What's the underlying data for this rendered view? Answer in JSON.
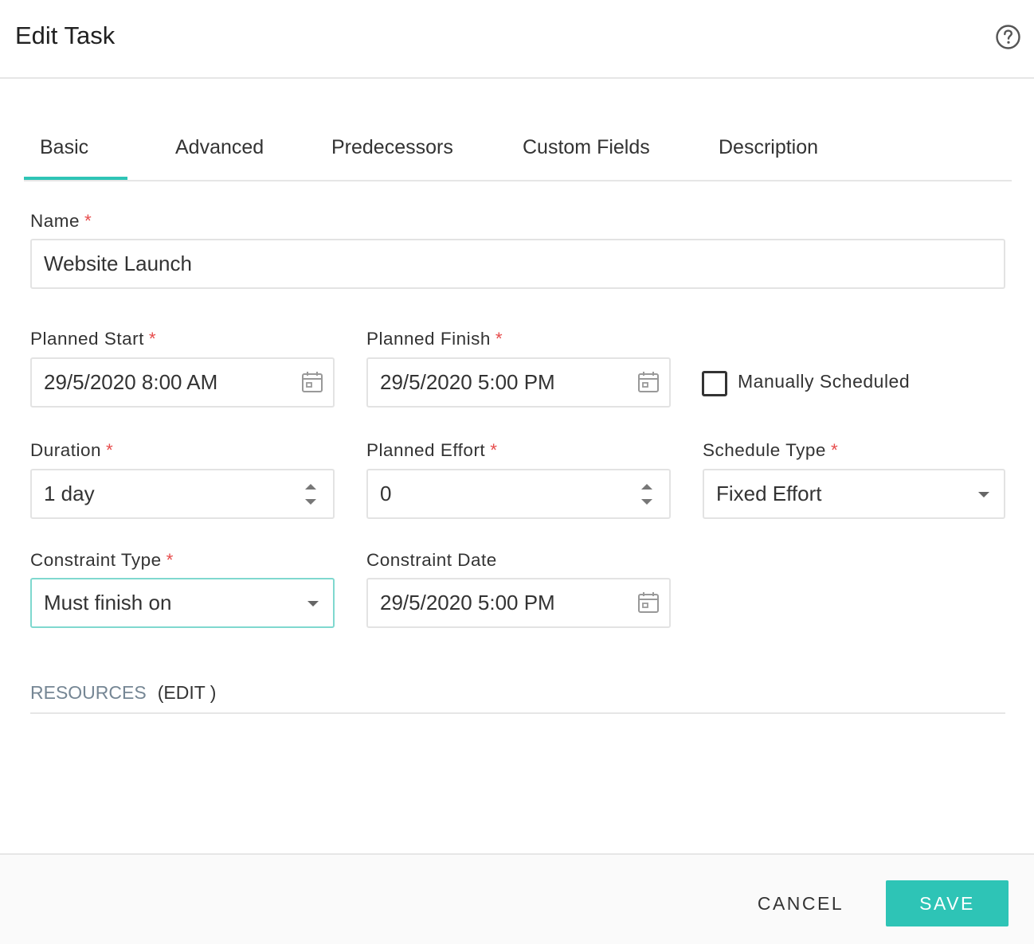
{
  "header": {
    "title": "Edit Task",
    "help_icon": "help-circle-icon"
  },
  "tabs": [
    {
      "label": "Basic",
      "active": true
    },
    {
      "label": "Advanced",
      "active": false
    },
    {
      "label": "Predecessors",
      "active": false
    },
    {
      "label": "Custom Fields",
      "active": false
    },
    {
      "label": "Description",
      "active": false
    }
  ],
  "required_marker": "*",
  "form": {
    "name": {
      "label": "Name",
      "value": "Website Launch"
    },
    "planned_start": {
      "label": "Planned Start",
      "value": "29/5/2020 8:00 AM",
      "icon": "calendar-icon"
    },
    "planned_finish": {
      "label": "Planned Finish",
      "value": "29/5/2020 5:00 PM",
      "icon": "calendar-icon"
    },
    "manually_scheduled": {
      "label": "Manually Scheduled",
      "checked": false
    },
    "duration": {
      "label": "Duration",
      "value": "1 day",
      "icon": "spinner-icon"
    },
    "planned_effort": {
      "label": "Planned Effort",
      "value": "0",
      "icon": "spinner-icon"
    },
    "schedule_type": {
      "label": "Schedule Type",
      "value": "Fixed Effort",
      "icon": "caret-down-icon"
    },
    "constraint_type": {
      "label": "Constraint Type",
      "value": "Must finish on",
      "icon": "caret-down-icon"
    },
    "constraint_date": {
      "label": "Constraint Date",
      "value": "29/5/2020 5:00 PM",
      "icon": "calendar-icon"
    }
  },
  "resources": {
    "title": "RESOURCES",
    "edit_label": "(EDIT )"
  },
  "footer": {
    "cancel_label": "CANCEL",
    "save_label": "SAVE"
  },
  "colors": {
    "accent": "#2ec4b6",
    "required": "#e74c4c",
    "muted": "#758694"
  }
}
